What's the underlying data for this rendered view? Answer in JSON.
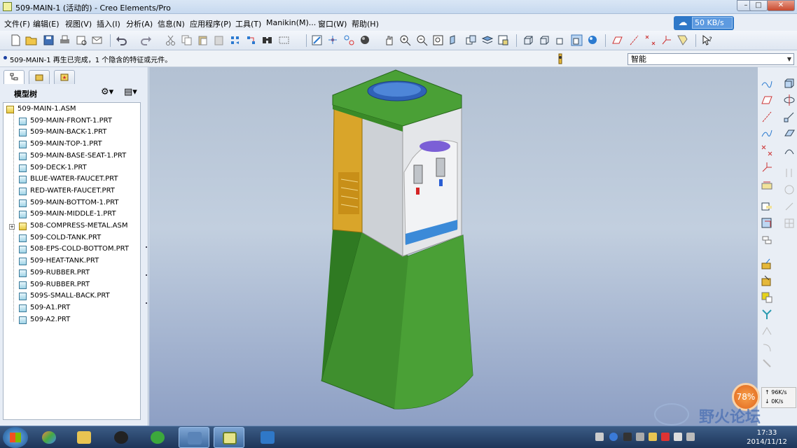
{
  "window": {
    "title": "509-MAIN-1 (活动的) - Creo Elements/Pro"
  },
  "menu": {
    "items": [
      "文件(F)",
      "编辑(E)",
      "视图(V)",
      "插入(I)",
      "分析(A)",
      "信息(N)",
      "应用程序(P)",
      "工具(T)",
      "Manikin(M)...",
      "窗口(W)",
      "帮助(H)"
    ]
  },
  "net_badge": {
    "speed": "50 KB/s"
  },
  "message": {
    "text": "509-MAIN-1 再生已完成，1 个隐含的特征或元件。"
  },
  "filter": {
    "selected": "智能"
  },
  "model_tree": {
    "header": "模型树",
    "items": [
      {
        "label": "509-MAIN-1.ASM",
        "type": "asm",
        "level": 0
      },
      {
        "label": "509-MAIN-FRONT-1.PRT",
        "type": "prt",
        "level": 1
      },
      {
        "label": "509-MAIN-BACK-1.PRT",
        "type": "prt",
        "level": 1
      },
      {
        "label": "509-MAIN-TOP-1.PRT",
        "type": "prt",
        "level": 1
      },
      {
        "label": "509-MAIN-BASE-SEAT-1.PRT",
        "type": "prt",
        "level": 1
      },
      {
        "label": "509-DECK-1.PRT",
        "type": "prt",
        "level": 1
      },
      {
        "label": "BLUE-WATER-FAUCET.PRT",
        "type": "prt",
        "level": 1
      },
      {
        "label": "RED-WATER-FAUCET.PRT",
        "type": "prt",
        "level": 1
      },
      {
        "label": "509-MAIN-BOTTOM-1.PRT",
        "type": "prt",
        "level": 1
      },
      {
        "label": "509-MAIN-MIDDLE-1.PRT",
        "type": "prt",
        "level": 1
      },
      {
        "label": "508-COMPRESS-METAL.ASM",
        "type": "asm",
        "level": 1
      },
      {
        "label": "509-COLD-TANK.PRT",
        "type": "prt",
        "level": 1
      },
      {
        "label": "508-EPS-COLD-BOTTOM.PRT",
        "type": "prt",
        "level": 1
      },
      {
        "label": "509-HEAT-TANK.PRT",
        "type": "prt",
        "level": 1
      },
      {
        "label": "509-RUBBER.PRT",
        "type": "prt",
        "level": 1
      },
      {
        "label": "509-RUBBER.PRT",
        "type": "prt",
        "level": 1
      },
      {
        "label": "509S-SMALL-BACK.PRT",
        "type": "prt",
        "level": 1
      },
      {
        "label": "509-A1.PRT",
        "type": "prt",
        "level": 1
      },
      {
        "label": "509-A2.PRT",
        "type": "prt",
        "level": 1
      }
    ]
  },
  "net_widget": {
    "percent": "78%",
    "up": "96K/s",
    "down": "0K/s"
  },
  "watermark": {
    "text": "野火论坛"
  },
  "clock": {
    "time": "17:33",
    "date": "2014/11/12"
  },
  "colors": {
    "model_green": "#3f8f2e",
    "model_grey": "#d8dadc",
    "model_yellow": "#d9a52a",
    "viewport_top": "#b3c1d3",
    "viewport_bottom": "#8d9fc4"
  }
}
